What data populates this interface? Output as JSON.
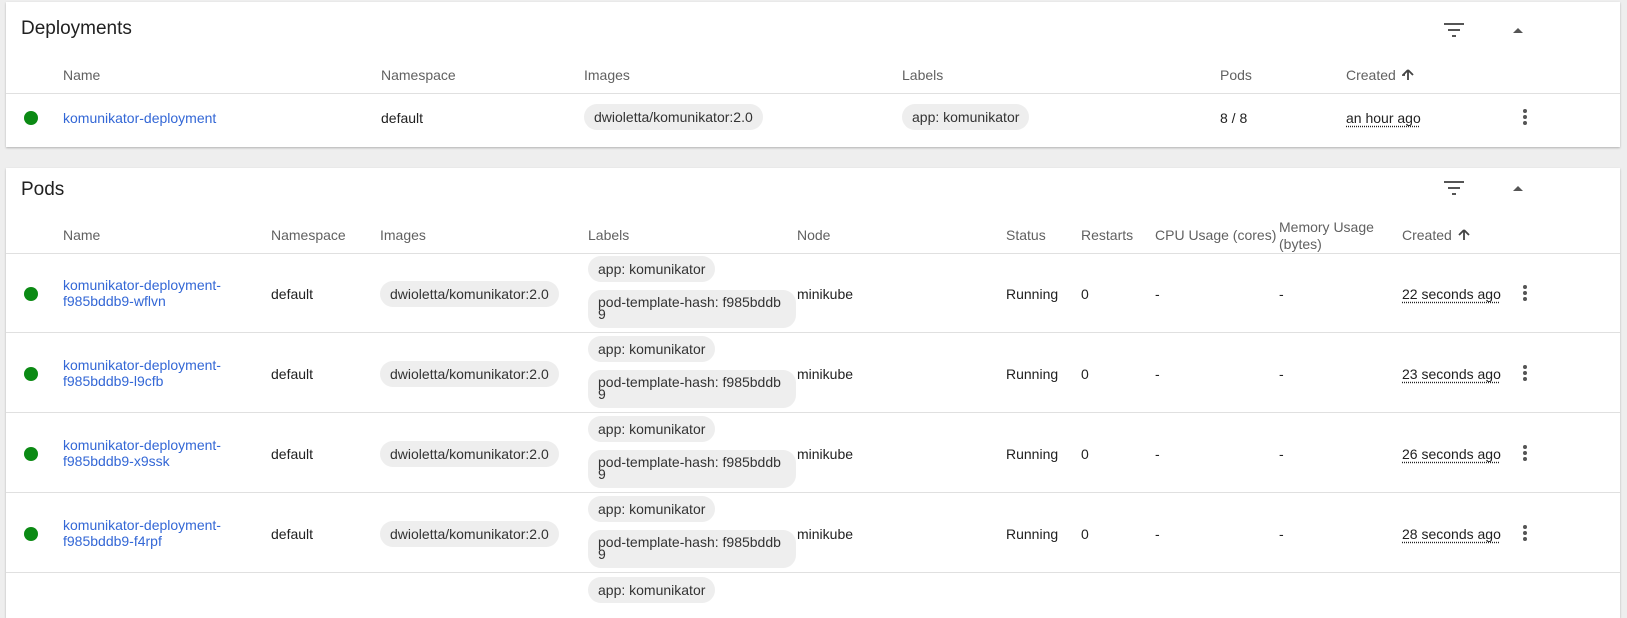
{
  "deployments": {
    "title": "Deployments",
    "headers": {
      "name": "Name",
      "namespace": "Namespace",
      "images": "Images",
      "labels": "Labels",
      "pods": "Pods",
      "created": "Created"
    },
    "row": {
      "name": "komunikator-deployment",
      "namespace": "default",
      "image": "dwioletta/komunikator:2.0",
      "label": "app: komunikator",
      "pods": "8 / 8",
      "created": "an hour ago"
    }
  },
  "pods": {
    "title": "Pods",
    "headers": {
      "name": "Name",
      "namespace": "Namespace",
      "images": "Images",
      "labels": "Labels",
      "node": "Node",
      "status": "Status",
      "restarts": "Restarts",
      "cpu": "CPU Usage (cores)",
      "memory_1": "Memory Usage",
      "memory_2": "(bytes)",
      "created": "Created"
    },
    "rows": [
      {
        "name_1": "komunikator-deployment-",
        "name_2": "f985bddb9-wflvn",
        "namespace": "default",
        "image": "dwioletta/komunikator:2.0",
        "label_app": "app: komunikator",
        "label_hash_1": "pod-template-hash: f985bddb",
        "label_hash_2": "9",
        "node": "minikube",
        "status": "Running",
        "restarts": "0",
        "cpu": "-",
        "memory": "-",
        "created": "22 seconds ago"
      },
      {
        "name_1": "komunikator-deployment-",
        "name_2": "f985bddb9-l9cfb",
        "namespace": "default",
        "image": "dwioletta/komunikator:2.0",
        "label_app": "app: komunikator",
        "label_hash_1": "pod-template-hash: f985bddb",
        "label_hash_2": "9",
        "node": "minikube",
        "status": "Running",
        "restarts": "0",
        "cpu": "-",
        "memory": "-",
        "created": "23 seconds ago"
      },
      {
        "name_1": "komunikator-deployment-",
        "name_2": "f985bddb9-x9ssk",
        "namespace": "default",
        "image": "dwioletta/komunikator:2.0",
        "label_app": "app: komunikator",
        "label_hash_1": "pod-template-hash: f985bddb",
        "label_hash_2": "9",
        "node": "minikube",
        "status": "Running",
        "restarts": "0",
        "cpu": "-",
        "memory": "-",
        "created": "26 seconds ago"
      },
      {
        "name_1": "komunikator-deployment-",
        "name_2": "f985bddb9-f4rpf",
        "namespace": "default",
        "image": "dwioletta/komunikator:2.0",
        "label_app": "app: komunikator",
        "label_hash_1": "pod-template-hash: f985bddb",
        "label_hash_2": "9",
        "node": "minikube",
        "status": "Running",
        "restarts": "0",
        "cpu": "-",
        "memory": "-",
        "created": "28 seconds ago"
      }
    ],
    "partial_label": "app: komunikator"
  },
  "colors": {
    "accent": "#3367d6",
    "status_ok": "#0b8a14",
    "chip": "#eeeeee"
  },
  "icons": {
    "filter": "filter-icon",
    "collapse": "chevron-up-icon",
    "more": "more-vert-icon",
    "sort": "arrow-up-icon"
  }
}
